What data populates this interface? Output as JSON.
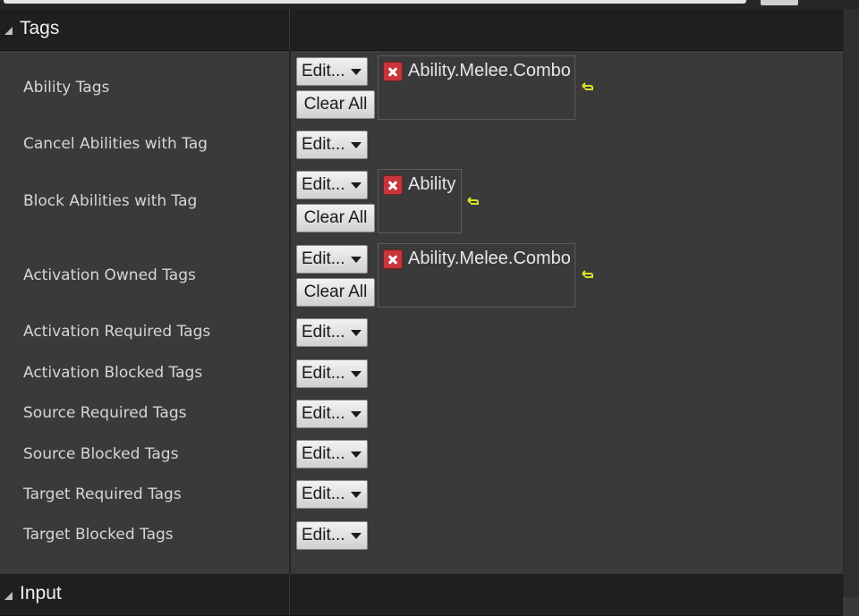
{
  "sections": {
    "tags": {
      "title": "Tags"
    },
    "input": {
      "title": "Input"
    }
  },
  "controls": {
    "edit_label": "Edit...",
    "clear_all_label": "Clear All"
  },
  "rows": [
    {
      "label": "Ability Tags",
      "tags": [
        "Ability.Melee.Combo"
      ]
    },
    {
      "label": "Cancel Abilities with Tag",
      "tags": []
    },
    {
      "label": "Block Abilities with Tag",
      "tags": [
        "Ability"
      ]
    },
    {
      "label": "Activation Owned Tags",
      "tags": [
        "Ability.Melee.Combo"
      ]
    },
    {
      "label": "Activation Required Tags",
      "tags": []
    },
    {
      "label": "Activation Blocked Tags",
      "tags": []
    },
    {
      "label": "Source Required Tags",
      "tags": []
    },
    {
      "label": "Source Blocked Tags",
      "tags": []
    },
    {
      "label": "Target Required Tags",
      "tags": []
    },
    {
      "label": "Target Blocked Tags",
      "tags": []
    }
  ],
  "icons": {
    "remove_tag": "remove-tag-icon",
    "reset_to_default": "reset-to-default-icon",
    "collapse": "collapse-triangle-icon"
  },
  "colors": {
    "panel_bg": "#3a3a3a",
    "header_bg": "#1f1f1f",
    "remove_icon": "#c9353a",
    "reset_icon": "#d9e02a"
  }
}
